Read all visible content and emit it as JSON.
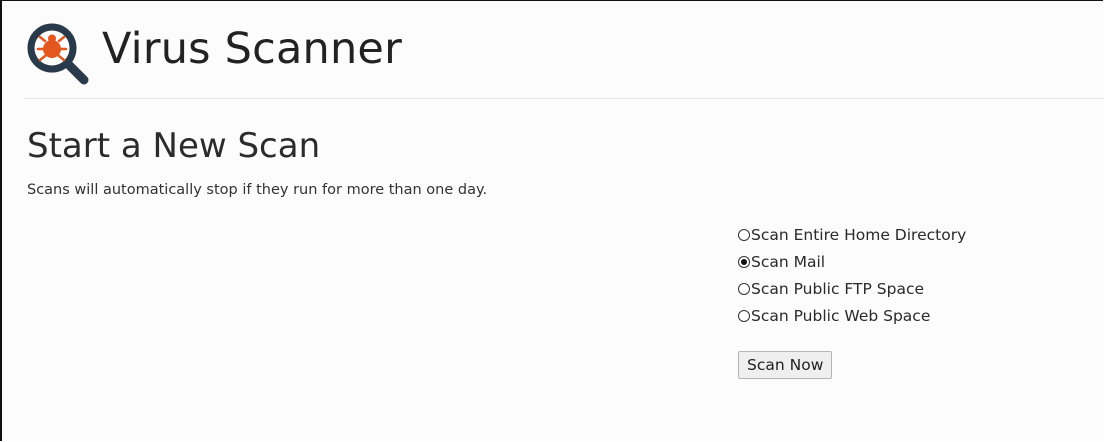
{
  "header": {
    "title": "Virus Scanner",
    "icon": "virus-scanner-magnifier-icon"
  },
  "scan": {
    "heading": "Start a New Scan",
    "description": "Scans will automatically stop if they run for more than one day.",
    "options": [
      {
        "label": "Scan Entire Home Directory",
        "selected": false
      },
      {
        "label": "Scan Mail",
        "selected": true
      },
      {
        "label": "Scan Public FTP Space",
        "selected": false
      },
      {
        "label": "Scan Public Web Space",
        "selected": false
      }
    ],
    "button_label": "Scan Now"
  },
  "colors": {
    "accent": "#e4571f",
    "icon_dark": "#293a4a"
  }
}
